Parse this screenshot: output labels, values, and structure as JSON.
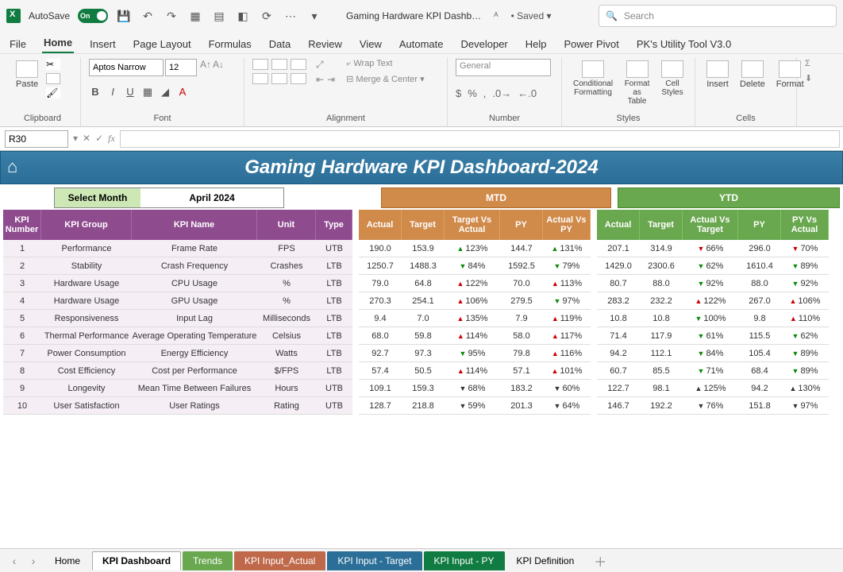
{
  "titlebar": {
    "autosave_label": "AutoSave",
    "autosave_state": "On",
    "file_title": "Gaming Hardware KPI Dashb…",
    "saved_label": "Saved",
    "search_placeholder": "Search"
  },
  "ribbon_tabs": [
    "File",
    "Home",
    "Insert",
    "Page Layout",
    "Formulas",
    "Data",
    "Review",
    "View",
    "Automate",
    "Developer",
    "Help",
    "Power Pivot",
    "PK's Utility Tool V3.0"
  ],
  "ribbon_active_tab": "Home",
  "ribbon": {
    "clipboard": {
      "paste": "Paste",
      "label": "Clipboard"
    },
    "font": {
      "name": "Aptos Narrow",
      "size": "12",
      "label": "Font"
    },
    "alignment": {
      "wrap": "Wrap Text",
      "merge": "Merge & Center",
      "label": "Alignment"
    },
    "number": {
      "format": "General",
      "label": "Number"
    },
    "styles": {
      "cf": "Conditional Formatting",
      "fat": "Format as Table",
      "cs": "Cell Styles",
      "label": "Styles"
    },
    "cells": {
      "insert": "Insert",
      "delete": "Delete",
      "format": "Format",
      "label": "Cells"
    }
  },
  "namebox": "R30",
  "dashboard": {
    "title": "Gaming Hardware KPI Dashboard-2024",
    "select_month_label": "Select Month",
    "select_month_value": "April 2024",
    "mtd_label": "MTD",
    "ytd_label": "YTD",
    "left_headers": [
      "KPI Number",
      "KPI Group",
      "KPI Name",
      "Unit",
      "Type"
    ],
    "mtd_headers": [
      "Actual",
      "Target",
      "Target Vs Actual",
      "PY",
      "Actual Vs PY"
    ],
    "ytd_headers": [
      "Actual",
      "Target",
      "Actual Vs Target",
      "PY",
      "PY Vs Actual"
    ],
    "rows": [
      {
        "num": "1",
        "group": "Performance",
        "name": "Frame Rate",
        "unit": "FPS",
        "type": "UTB",
        "mtd": {
          "actual": "190.0",
          "target": "153.9",
          "tva_dir": "up-g",
          "tva": "123%",
          "py": "144.7",
          "avp_dir": "up-g",
          "avp": "131%"
        },
        "ytd": {
          "actual": "207.1",
          "target": "314.9",
          "avt_dir": "dn-r-red",
          "avt": "66%",
          "py": "296.0",
          "pva_dir": "dn-r-red",
          "pva": "70%"
        }
      },
      {
        "num": "2",
        "group": "Stability",
        "name": "Crash Frequency",
        "unit": "Crashes",
        "type": "LTB",
        "mtd": {
          "actual": "1250.7",
          "target": "1488.3",
          "tva_dir": "dn-g",
          "tva": "84%",
          "py": "1592.5",
          "avp_dir": "dn-g",
          "avp": "79%"
        },
        "ytd": {
          "actual": "1429.0",
          "target": "2300.6",
          "avt_dir": "dn-g",
          "avt": "62%",
          "py": "1610.4",
          "pva_dir": "dn-g",
          "pva": "89%"
        }
      },
      {
        "num": "3",
        "group": "Hardware Usage",
        "name": "CPU Usage",
        "unit": "%",
        "type": "LTB",
        "mtd": {
          "actual": "79.0",
          "target": "64.8",
          "tva_dir": "up-r",
          "tva": "122%",
          "py": "70.0",
          "avp_dir": "up-r",
          "avp": "113%"
        },
        "ytd": {
          "actual": "80.7",
          "target": "88.0",
          "avt_dir": "dn-g",
          "avt": "92%",
          "py": "88.0",
          "pva_dir": "dn-g",
          "pva": "92%"
        }
      },
      {
        "num": "4",
        "group": "Hardware Usage",
        "name": "GPU Usage",
        "unit": "%",
        "type": "LTB",
        "mtd": {
          "actual": "270.3",
          "target": "254.1",
          "tva_dir": "up-r",
          "tva": "106%",
          "py": "279.5",
          "avp_dir": "dn-g",
          "avp": "97%"
        },
        "ytd": {
          "actual": "283.2",
          "target": "232.2",
          "avt_dir": "up-r",
          "avt": "122%",
          "py": "267.0",
          "pva_dir": "up-r",
          "pva": "106%"
        }
      },
      {
        "num": "5",
        "group": "Responsiveness",
        "name": "Input Lag",
        "unit": "Milliseconds",
        "type": "LTB",
        "mtd": {
          "actual": "9.4",
          "target": "7.0",
          "tva_dir": "up-r",
          "tva": "135%",
          "py": "7.9",
          "avp_dir": "up-r",
          "avp": "119%"
        },
        "ytd": {
          "actual": "10.8",
          "target": "10.8",
          "avt_dir": "dn-g",
          "avt": "100%",
          "py": "9.8",
          "pva_dir": "up-r",
          "pva": "110%"
        }
      },
      {
        "num": "6",
        "group": "Thermal Performance",
        "name": "Average Operating Temperature",
        "unit": "Celsius",
        "type": "LTB",
        "mtd": {
          "actual": "68.0",
          "target": "59.8",
          "tva_dir": "up-r",
          "tva": "114%",
          "py": "58.0",
          "avp_dir": "up-r",
          "avp": "117%"
        },
        "ytd": {
          "actual": "71.4",
          "target": "117.9",
          "avt_dir": "dn-g",
          "avt": "61%",
          "py": "115.5",
          "pva_dir": "dn-g",
          "pva": "62%"
        }
      },
      {
        "num": "7",
        "group": "Power Consumption",
        "name": "Energy Efficiency",
        "unit": "Watts",
        "type": "LTB",
        "mtd": {
          "actual": "92.7",
          "target": "97.3",
          "tva_dir": "dn-g",
          "tva": "95%",
          "py": "79.8",
          "avp_dir": "up-r",
          "avp": "116%"
        },
        "ytd": {
          "actual": "94.2",
          "target": "112.1",
          "avt_dir": "dn-g",
          "avt": "84%",
          "py": "105.4",
          "pva_dir": "dn-g",
          "pva": "89%"
        }
      },
      {
        "num": "8",
        "group": "Cost Efficiency",
        "name": "Cost per Performance",
        "unit": "$/FPS",
        "type": "LTB",
        "mtd": {
          "actual": "57.4",
          "target": "50.5",
          "tva_dir": "up-r",
          "tva": "114%",
          "py": "57.1",
          "avp_dir": "up-r",
          "avp": "101%"
        },
        "ytd": {
          "actual": "60.7",
          "target": "85.5",
          "avt_dir": "dn-g",
          "avt": "71%",
          "py": "68.4",
          "pva_dir": "dn-g",
          "pva": "89%"
        }
      },
      {
        "num": "9",
        "group": "Longevity",
        "name": "Mean Time Between Failures",
        "unit": "Hours",
        "type": "UTB",
        "mtd": {
          "actual": "109.1",
          "target": "159.3",
          "tva_dir": "dn-r",
          "tva": "68%",
          "py": "183.2",
          "avp_dir": "dn-r",
          "avp": "60%"
        },
        "ytd": {
          "actual": "122.7",
          "target": "98.1",
          "avt_dir": "flat",
          "avt": "125%",
          "py": "94.2",
          "pva_dir": "flat",
          "pva": "130%"
        }
      },
      {
        "num": "10",
        "group": "User Satisfaction",
        "name": "User Ratings",
        "unit": "Rating",
        "type": "UTB",
        "mtd": {
          "actual": "128.7",
          "target": "218.8",
          "tva_dir": "dn-r",
          "tva": "59%",
          "py": "201.3",
          "avp_dir": "dn-r",
          "avp": "64%"
        },
        "ytd": {
          "actual": "146.7",
          "target": "192.2",
          "avt_dir": "dn-r",
          "avt": "76%",
          "py": "151.8",
          "pva_dir": "dn-r",
          "pva": "97%"
        }
      }
    ]
  },
  "sheet_tabs": [
    {
      "label": "Home",
      "cls": ""
    },
    {
      "label": "KPI Dashboard",
      "cls": "active"
    },
    {
      "label": "Trends",
      "cls": "green"
    },
    {
      "label": "KPI Input_Actual",
      "cls": "orange"
    },
    {
      "label": "KPI Input - Target",
      "cls": "blue"
    },
    {
      "label": "KPI Input - PY",
      "cls": "dgreen"
    },
    {
      "label": "KPI Definition",
      "cls": ""
    }
  ]
}
